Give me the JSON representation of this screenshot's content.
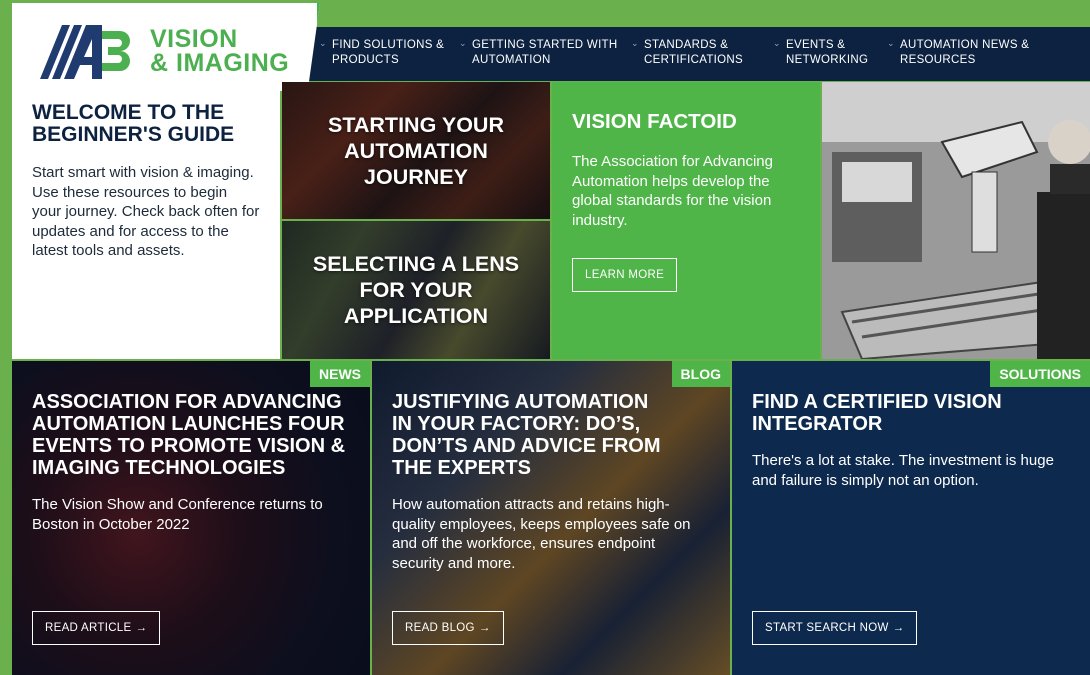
{
  "brand": {
    "mark_text": "A3",
    "name_line1": "VISION",
    "name_line2": "& IMAGING"
  },
  "nav": {
    "items": [
      {
        "line1": "FIND SOLUTIONS &",
        "line2": "PRODUCTS"
      },
      {
        "line1": "GETTING STARTED WITH",
        "line2": "AUTOMATION"
      },
      {
        "line1": "STANDARDS &",
        "line2": "CERTIFICATIONS"
      },
      {
        "line1": "EVENTS &",
        "line2": "NETWORKING"
      },
      {
        "line1": "AUTOMATION NEWS &",
        "line2": "RESOURCES"
      }
    ],
    "chevron_icon": "chevron-down-icon"
  },
  "welcome": {
    "title": "WELCOME TO THE BEGINNER'S GUIDE",
    "body": "Start smart with vision & imaging. Use these resources to begin your journey. Check back often for updates and for access to the latest tools and assets."
  },
  "tiles": {
    "journey": "STARTING YOUR AUTOMATION JOURNEY",
    "lens": "SELECTING A LENS FOR YOUR APPLICATION"
  },
  "factoid": {
    "title": "VISION FACTOID",
    "body": "The Association for Advancing Automation helps develop the global standards for the vision industry.",
    "button": "LEARN MORE"
  },
  "cards": {
    "news": {
      "tag": "NEWS",
      "title": "ASSOCIATION FOR ADVANCING AUTOMATION LAUNCHES FOUR EVENTS TO PROMOTE VISION & IMAGING TECHNOLOGIES",
      "body": "The Vision Show and Conference returns to Boston in October 2022",
      "button": "READ ARTICLE"
    },
    "blog": {
      "tag": "BLOG",
      "title": "JUSTIFYING AUTOMATION IN YOUR FACTORY: DO’S, DON’TS AND ADVICE FROM THE EXPERTS",
      "body": "How automation attracts and retains high-quality employees, keeps employees safe on and off the workforce, ensures endpoint security and more.",
      "button": "READ BLOG"
    },
    "solutions": {
      "tag": "SOLUTIONS",
      "title": "FIND A CERTIFIED VISION INTEGRATOR",
      "body": "There's a lot at stake. The investment is huge and failure is simply not an option.",
      "button": "START SEARCH NOW"
    }
  },
  "icons": {
    "arrow": "arrow-right-icon"
  },
  "colors": {
    "brand_green": "#4fb548",
    "navy": "#0d2240"
  }
}
